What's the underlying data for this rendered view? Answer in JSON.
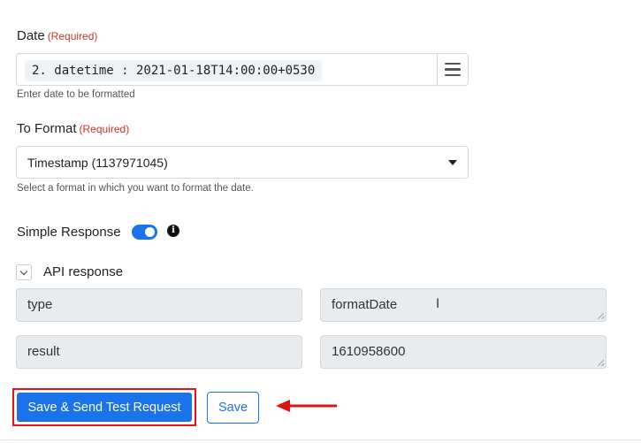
{
  "date_field": {
    "label": "Date",
    "required": "(Required)",
    "chip_value": "2. datetime : 2021-01-18T14:00:00+0530",
    "help": "Enter date to be formatted"
  },
  "format_field": {
    "label": "To Format",
    "required": "(Required)",
    "selected": "Timestamp (1137971045)",
    "help": "Select a format in which you want to format the date."
  },
  "simple_response": {
    "label": "Simple Response",
    "enabled": true,
    "info_glyph": "i"
  },
  "api_response": {
    "label": "API response",
    "rows": [
      {
        "key": "type",
        "value": "formatDate"
      },
      {
        "key": "result",
        "value": "1610958600"
      }
    ]
  },
  "actions": {
    "send_label": "Save & Send Test Request",
    "save_label": "Save"
  },
  "colors": {
    "accent": "#1a73e8",
    "required": "#c0392b",
    "annotation": "#e11111"
  }
}
